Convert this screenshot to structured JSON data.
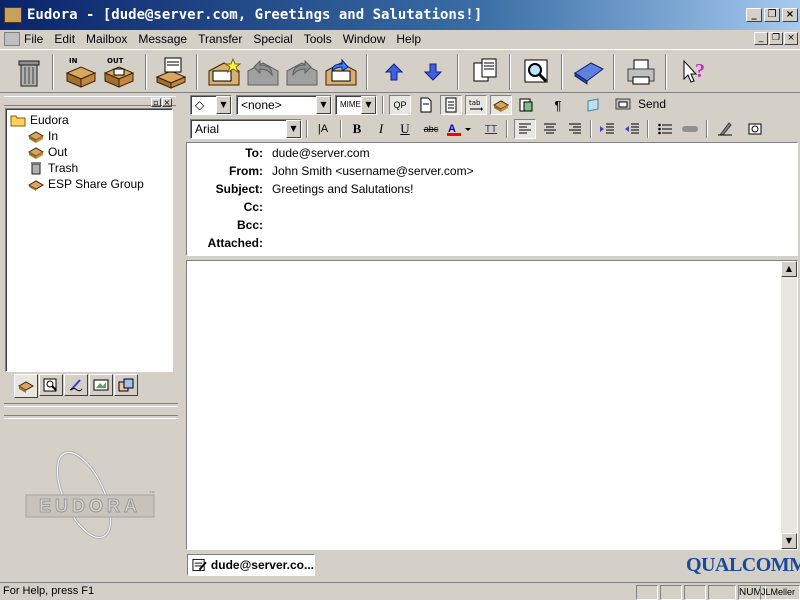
{
  "window": {
    "title": "Eudora - [dude@server.com, Greetings and Salutations!]",
    "minimize": "_",
    "maximize": "❐",
    "close": "×"
  },
  "menubar": {
    "items": [
      "File",
      "Edit",
      "Mailbox",
      "Message",
      "Transfer",
      "Special",
      "Tools",
      "Window",
      "Help"
    ]
  },
  "toolbar": {
    "in_label": "IN",
    "out_label": "OUT"
  },
  "mailboxes": {
    "root": "Eudora",
    "items": [
      "In",
      "Out",
      "Trash",
      "ESP Share Group"
    ]
  },
  "logo": {
    "text": "EUDORA",
    "tm": "™"
  },
  "compose": {
    "signature_value": "◇",
    "stationery_value": "<none>",
    "encoding_value": "MIME",
    "qp_label": "QP",
    "send_label": "Send",
    "font_value": "Arial"
  },
  "headers": {
    "to_label": "To:",
    "to_value": "dude@server.com",
    "from_label": "From:",
    "from_value": "John Smith <username@server.com>",
    "subject_label": "Subject:",
    "subject_value": "Greetings and Salutations!",
    "cc_label": "Cc:",
    "cc_value": "",
    "bcc_label": "Bcc:",
    "bcc_value": "",
    "attached_label": "Attached:",
    "attached_value": ""
  },
  "taskbar": {
    "window_label": "dude@server.co..."
  },
  "brand": "QUALCOMM",
  "statusbar": {
    "help_text": "For Help, press F1",
    "num": "NUM",
    "user": "JLMeller"
  }
}
